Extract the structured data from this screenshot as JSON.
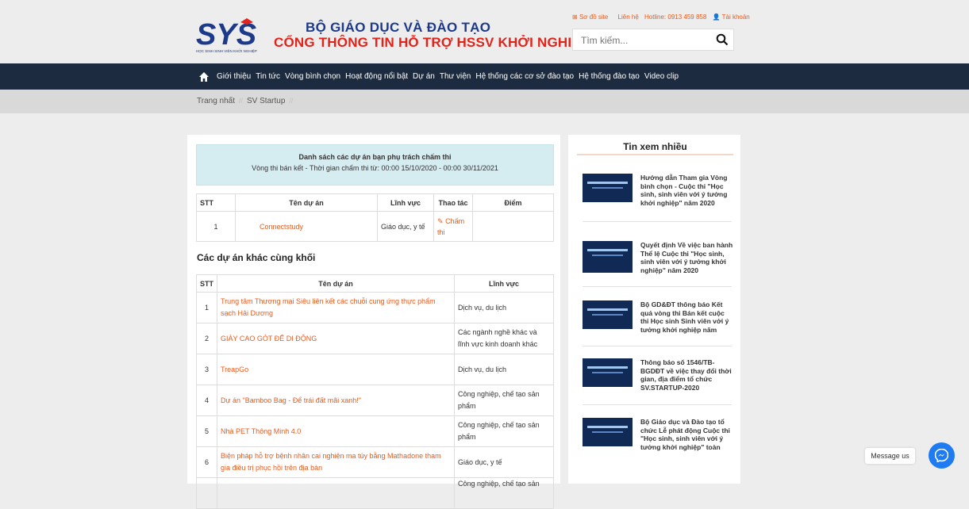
{
  "header": {
    "brand_line1": "BỘ GIÁO DỤC VÀ ĐÀO TẠO",
    "brand_line2": "CỔNG THÔNG TIN HỖ TRỢ HSSV KHỞI NGHIỆP",
    "logo_text": "SYS",
    "logo_caption": "HỌC SINH SINH VIÊN KHỞI NGHIỆP",
    "top_links": [
      "Sơ đồ site",
      "Liên hệ",
      "Hotline: 0913 459 858",
      "Tài khoản"
    ],
    "search_placeholder": "Tìm kiếm..."
  },
  "nav": {
    "items": [
      "Giới thiệu",
      "Tin tức",
      "Vòng bình chọn",
      "Hoạt động nổi bật",
      "Dự án",
      "Thư viện",
      "Hệ thống các cơ sở đào tạo",
      "Hệ thống đào tạo",
      "Video clip"
    ]
  },
  "breadcrumb": [
    "Trang nhất",
    "SV Startup"
  ],
  "alert": {
    "title": "Danh sách các dự án bạn phụ trách chấm thi",
    "subtitle": "Vòng thi bán kết - Thời gian chấm thi từ: 00:00 15/10/2020 - 00:00 30/11/2021"
  },
  "table1": {
    "headers": [
      "STT",
      "Tên dự án",
      "Lĩnh vực",
      "Thao tác",
      "Điểm"
    ],
    "rows": [
      {
        "stt": "1",
        "name": "Connectstudy",
        "field": "Giáo dục, y tế",
        "action": "Chấm thi",
        "score": ""
      }
    ]
  },
  "section_title": "Các dự án khác cùng khối",
  "table2": {
    "headers": [
      "STT",
      "Tên dự án",
      "Lĩnh vực"
    ],
    "rows": [
      {
        "stt": "1",
        "name": "Trung tâm Thương mại Siêu liên kết các chuỗi cung ứng thực phẩm sạch Hải Dương",
        "field": "Dịch vụ, du lịch"
      },
      {
        "stt": "2",
        "name": "GIÀY CAO GÓT ĐẾ DI ĐỘNG",
        "field": "Các ngành nghề khác và lĩnh vực kinh doanh khác"
      },
      {
        "stt": "3",
        "name": "TreapGo",
        "field": "Dịch vụ, du lịch"
      },
      {
        "stt": "4",
        "name": "Dự án \"Bamboo Bag - Để trái đất mãi xanh!\"",
        "field": "Công nghiệp, chế tạo sản phẩm"
      },
      {
        "stt": "5",
        "name": "Nhà PET Thông Minh 4.0",
        "field": "Công nghiệp, chế tạo sản phẩm"
      },
      {
        "stt": "6",
        "name": "Biện pháp hỗ trợ bệnh nhân cai nghiện ma túy bằng Mathadone tham gia điều trị phục hồi trên địa bàn",
        "field": "Giáo dục, y tế"
      },
      {
        "stt": "",
        "name": "",
        "field": "Công nghiệp, chế tạo sản"
      }
    ]
  },
  "sidebar": {
    "title": "Tin xem nhiều",
    "news": [
      "Hướng dẫn Tham gia Vòng bình chọn - Cuộc thi \"Học sinh, sinh viên với ý tưởng khởi nghiệp\" năm 2020",
      "Quyết định Về việc ban hành Thể lệ Cuộc thi \"Học sinh, sinh viên với ý tưởng khởi nghiệp\" năm 2020",
      "Bộ GD&ĐT thông báo Kết quả vòng thi Bán kết cuộc thi Học sinh Sinh viên với ý tưởng khởi nghiệp năm",
      "Thông báo số 1546/TB-BGDĐT về việc thay đổi thời gian, địa điểm tổ chức SV.STARTUP-2020",
      "Bộ Giáo dục và Đào tạo tổ chức Lễ phát động Cuộc thi \"Học sinh, sinh viên với ý tưởng khởi nghiệp\" toàn"
    ]
  },
  "messenger": {
    "label": "Message us"
  },
  "colors": {
    "brand_blue": "#1d3a8a",
    "brand_red": "#e2231a",
    "nav_bg": "#1c2b3f",
    "link_orange": "#e65b1e",
    "alert_bg": "#d5ecf1"
  }
}
